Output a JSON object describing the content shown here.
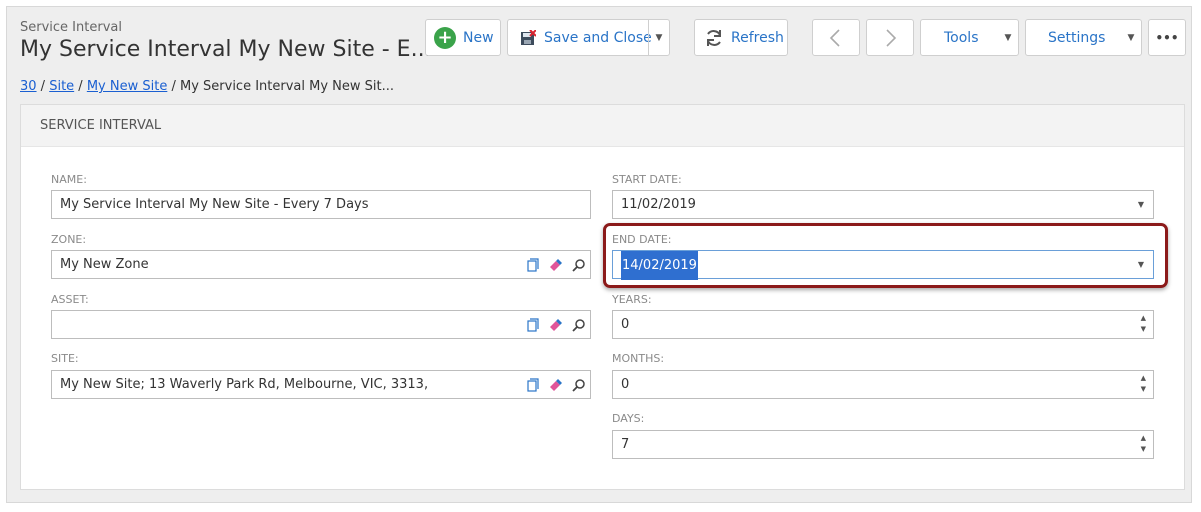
{
  "header": {
    "entity_type": "Service Interval",
    "title": "My Service Interval My New Site - E..."
  },
  "toolbar": {
    "new_label": "New",
    "save_close_label": "Save and Close",
    "refresh_label": "Refresh",
    "tools_label": "Tools",
    "settings_label": "Settings",
    "more_label": "•••",
    "accent_color": "#2a74c7"
  },
  "breadcrumb": {
    "items": [
      "30",
      "Site",
      "My New Site"
    ],
    "current": "My Service Interval My New Sit...",
    "separator": " / "
  },
  "panel": {
    "title": "SERVICE INTERVAL"
  },
  "form": {
    "name": {
      "label": "NAME:",
      "value": "My Service Interval My New Site - Every 7 Days"
    },
    "zone": {
      "label": "ZONE:",
      "value": "My New Zone"
    },
    "asset": {
      "label": "ASSET:",
      "value": ""
    },
    "site": {
      "label": "SITE:",
      "value": "My New Site; 13 Waverly Park Rd, Melbourne, VIC, 3313,"
    },
    "start_date": {
      "label": "START DATE:",
      "value": "11/02/2019"
    },
    "end_date": {
      "label": "END DATE:",
      "value": "14/02/2019"
    },
    "years": {
      "label": "YEARS:",
      "value": "0"
    },
    "months": {
      "label": "MONTHS:",
      "value": "0"
    },
    "days": {
      "label": "DAYS:",
      "value": "7"
    }
  },
  "icons": {
    "new": "plus-circle-icon",
    "save": "floppy-icon",
    "refresh": "refresh-icon",
    "prev": "chevron-left-icon",
    "next": "chevron-right-icon",
    "copy": "copy-icon",
    "clear": "eraser-icon",
    "search": "search-icon"
  }
}
